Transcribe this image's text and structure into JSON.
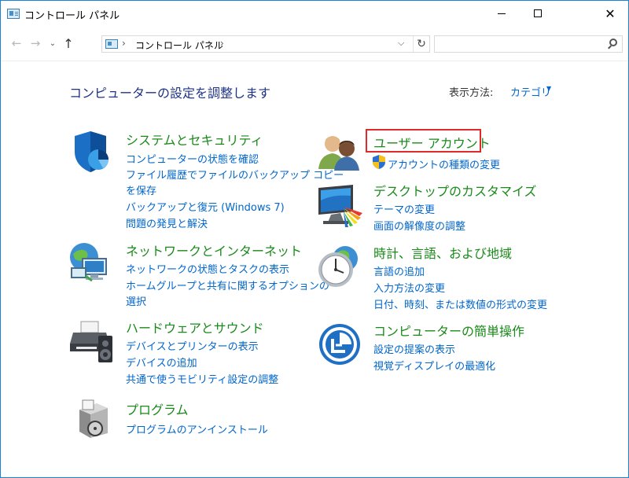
{
  "window": {
    "title": "コントロール パネル"
  },
  "address": {
    "path": "コントロール パネル",
    "search_placeholder": ""
  },
  "heading": "コンピューターの設定を調整します",
  "view_by": {
    "label": "表示方法:",
    "value": "カテゴリ"
  },
  "categories": {
    "system": {
      "title": "システムとセキュリティ",
      "links": [
        "コンピューターの状態を確認",
        "ファイル履歴でファイルのバックアップ コピー",
        "を保存",
        "バックアップと復元 (Windows 7)",
        "問題の発見と解決"
      ]
    },
    "network": {
      "title": "ネットワークとインターネット",
      "links": [
        "ネットワークの状態とタスクの表示",
        "ホームグループと共有に関するオプションの",
        "選択"
      ]
    },
    "hardware": {
      "title": "ハードウェアとサウンド",
      "links": [
        "デバイスとプリンターの表示",
        "デバイスの追加",
        "共通で使うモビリティ設定の調整"
      ]
    },
    "programs": {
      "title": "プログラム",
      "links": [
        "プログラムのアンインストール"
      ]
    },
    "user": {
      "title": "ユーザー アカウント",
      "links": [
        "アカウントの種類の変更"
      ]
    },
    "desktop": {
      "title": "デスクトップのカスタマイズ",
      "links": [
        "テーマの変更",
        "画面の解像度の調整"
      ]
    },
    "clock": {
      "title": "時計、言語、および地域",
      "links": [
        "言語の追加",
        "入力方法の変更",
        "日付、時刻、または数値の形式の変更"
      ]
    },
    "ease": {
      "title": "コンピューターの簡単操作",
      "links": [
        "設定の提案の表示",
        "視覚ディスプレイの最適化"
      ]
    }
  },
  "colors": {
    "accent_border": "#1883d7",
    "heading": "#1e3287",
    "category_title": "#1a8a1a",
    "link": "#0066cc",
    "highlight": "#e02a2a"
  }
}
